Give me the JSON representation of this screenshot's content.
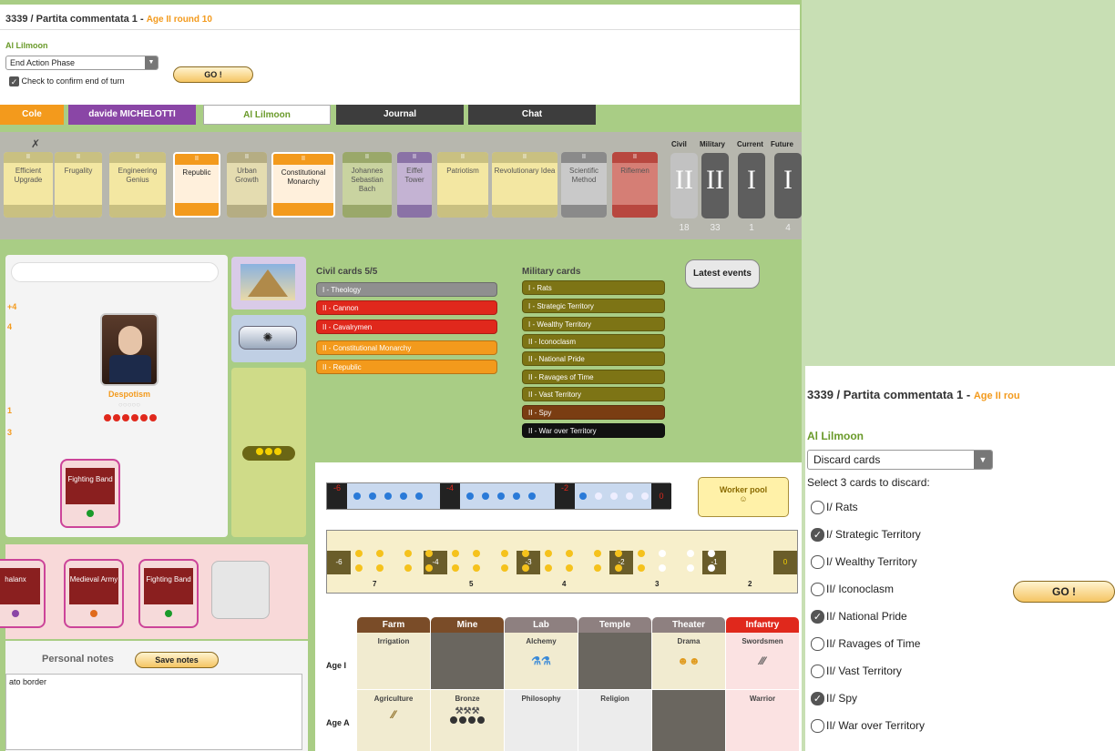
{
  "header": {
    "game_title": "3339 / Partita commentata 1 - ",
    "age_info": "Age II round 10"
  },
  "action": {
    "player": "Al Lilmoon",
    "select_value": "End Action Phase",
    "confirm_label": "Check to confirm end of turn",
    "go_label": "GO !"
  },
  "tabs": [
    {
      "label": "Cole",
      "color": "#f39a1c"
    },
    {
      "label": "davide MICHELOTTI",
      "color": "#8a46a6"
    },
    {
      "label": "Al Lilmoon",
      "color": "#ffffff"
    },
    {
      "label": "Journal",
      "color": "#3d3d3d"
    },
    {
      "label": "Chat",
      "color": "#3d3d3d"
    }
  ],
  "cardrow": {
    "close": "✗",
    "cards": [
      {
        "age": "II",
        "name": "Efficient Upgrade",
        "hdcolor": "#c9c081",
        "bodycolor": "#f3e7a2"
      },
      {
        "age": "II",
        "name": "Frugality",
        "hdcolor": "#c9c081",
        "bodycolor": "#f3e7a2"
      },
      {
        "age": "II",
        "name": "Engineering Genius",
        "hdcolor": "#c9c081",
        "bodycolor": "#f3e7a2"
      },
      {
        "age": "II",
        "name": "Republic",
        "hdcolor": "#f39a1c",
        "bodycolor": "#fff0dc"
      },
      {
        "age": "II",
        "name": "Urban Growth",
        "hdcolor": "#b5ad83",
        "bodycolor": "#e4dcb0"
      },
      {
        "age": "II",
        "name": "Constitutional Monarchy",
        "hdcolor": "#f39a1c",
        "bodycolor": "#fff0dc"
      },
      {
        "age": "II",
        "name": "Johannes Sebastian Bach",
        "hdcolor": "#9aa86a",
        "bodycolor": "#c9d3a0"
      },
      {
        "age": "II",
        "name": "Eiffel Tower",
        "hdcolor": "#8a72a6",
        "bodycolor": "#c4b3d3"
      },
      {
        "age": "II",
        "name": "Patriotism",
        "hdcolor": "#c9c081",
        "bodycolor": "#f3e7a2"
      },
      {
        "age": "II",
        "name": "Revolutionary Idea",
        "hdcolor": "#c9c081",
        "bodycolor": "#f3e7a2"
      },
      {
        "age": "II",
        "name": "Scientific Method",
        "hdcolor": "#8a8a8a",
        "bodycolor": "#c9c9c9"
      },
      {
        "age": "II",
        "name": "Riflemen",
        "hdcolor": "#b8473f",
        "bodycolor": "#d57e75"
      }
    ],
    "decks": [
      {
        "label": "Civil",
        "roman": "II",
        "count": "18",
        "color": "#c2c2c2"
      },
      {
        "label": "Military",
        "roman": "II",
        "count": "33",
        "color": "#5e5e5e"
      },
      {
        "label": "Current",
        "roman": "I",
        "count": "1",
        "color": "#5e5e5e"
      },
      {
        "label": "Future",
        "roman": "I",
        "count": "4",
        "color": "#5e5e5e"
      }
    ]
  },
  "leader": {
    "government": "Despotism",
    "left_nums": [
      "+4",
      "4",
      "1",
      "3"
    ],
    "fighting_band": "Fighting Band"
  },
  "civil": {
    "title": "Civil cards 5/5",
    "cards": [
      {
        "label": "I - Theology",
        "color": "#8f8f8f"
      },
      {
        "label": "II - Cannon",
        "color": "#e0281c"
      },
      {
        "label": "II - Cavalrymen",
        "color": "#e0281c"
      },
      {
        "label": "II - Constitutional Monarchy",
        "color": "#f39a1c"
      },
      {
        "label": "II - Republic",
        "color": "#f39a1c"
      }
    ]
  },
  "military": {
    "title": "Military cards",
    "cards": [
      {
        "label": "I - Rats",
        "color": "#7d7415"
      },
      {
        "label": "I - Strategic Territory",
        "color": "#7d7415"
      },
      {
        "label": "I - Wealthy Territory",
        "color": "#7d7415"
      },
      {
        "label": "II - Iconoclasm",
        "color": "#7d7415"
      },
      {
        "label": "II - National Pride",
        "color": "#7d7415"
      },
      {
        "label": "II - Ravages of Time",
        "color": "#7d7415"
      },
      {
        "label": "II - Vast Territory",
        "color": "#7d7415"
      },
      {
        "label": "II - Spy",
        "color": "#7a3d12"
      },
      {
        "label": "II - War over Territory",
        "color": "#111111"
      }
    ],
    "latest_events": "Latest events"
  },
  "resources": {
    "bank_values": [
      "-6",
      "-4",
      "-2",
      "0"
    ],
    "worker_pool": "Worker pool",
    "row_values": [
      "-6",
      "-4",
      "-3",
      "-2",
      "-1",
      "0"
    ],
    "bottom_counts": [
      "7",
      "5",
      "4",
      "3",
      "2"
    ]
  },
  "buildings": {
    "headers": [
      {
        "label": "Farm",
        "color": "#7a4c28"
      },
      {
        "label": "Mine",
        "color": "#7a4c28"
      },
      {
        "label": "Lab",
        "color": "#8e8080"
      },
      {
        "label": "Temple",
        "color": "#8e8080"
      },
      {
        "label": "Theater",
        "color": "#8e8080"
      },
      {
        "label": "Infantry",
        "color": "#e0281c"
      }
    ],
    "age_rows": [
      "Age I",
      "Age A"
    ],
    "age1": [
      "Irrigation",
      "",
      "Alchemy",
      "",
      "Drama",
      "Swordsmen"
    ],
    "ageA": [
      "Agriculture",
      "Bronze",
      "Philosophy",
      "Religion",
      "",
      "Warrior"
    ]
  },
  "army": {
    "units": [
      "halanx",
      "Medieval Army",
      "Fighting Band"
    ]
  },
  "notes": {
    "title": "Personal notes",
    "save_label": "Save notes",
    "content": "ato border"
  },
  "discard_panel": {
    "game_title": "3339 / Partita commentata 1 - ",
    "age_info": "Age II rou",
    "player": "Al Lilmoon",
    "select_value": "Discard cards",
    "instruction": "Select 3 cards to discard:",
    "go_label": "GO !",
    "options": [
      {
        "label": "I/ Rats",
        "checked": false
      },
      {
        "label": "I/ Strategic Territory",
        "checked": true
      },
      {
        "label": "I/ Wealthy Territory",
        "checked": false
      },
      {
        "label": "II/ Iconoclasm",
        "checked": false
      },
      {
        "label": "II/ National Pride",
        "checked": true
      },
      {
        "label": "II/ Ravages of Time",
        "checked": false
      },
      {
        "label": "II/ Vast Territory",
        "checked": false
      },
      {
        "label": "II/ Spy",
        "checked": true
      },
      {
        "label": "II/ War over Territory",
        "checked": false
      }
    ]
  }
}
